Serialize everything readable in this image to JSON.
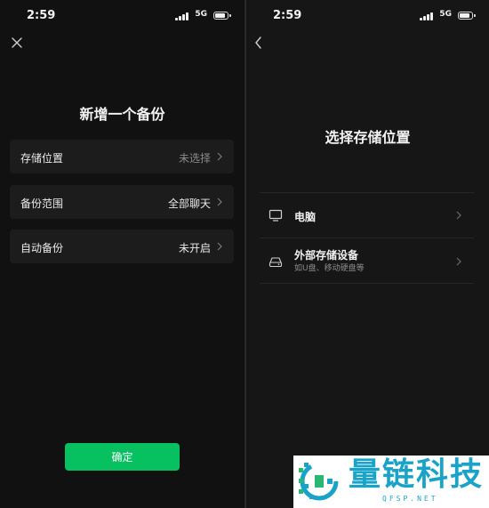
{
  "status_bar": {
    "time": "2:59",
    "network": "5G"
  },
  "left_screen": {
    "title": "新增一个备份",
    "rows": [
      {
        "label": "存储位置",
        "value": "未选择"
      },
      {
        "label": "备份范围",
        "value": "全部聊天"
      },
      {
        "label": "自动备份",
        "value": "未开启"
      }
    ],
    "confirm_label": "确定"
  },
  "right_screen": {
    "title": "选择存储位置",
    "options": [
      {
        "label": "电脑",
        "icon": "monitor-icon"
      },
      {
        "label": "外部存储设备",
        "sublabel": "如U盘、移动硬盘等",
        "icon": "drive-icon"
      }
    ]
  },
  "watermark": {
    "brand": "量链科技",
    "url": "QFSP.NET"
  },
  "colors": {
    "accent": "#07c160",
    "background": "#111111",
    "row_bg": "#1c1c1c",
    "watermark": "#1aa3c8"
  }
}
